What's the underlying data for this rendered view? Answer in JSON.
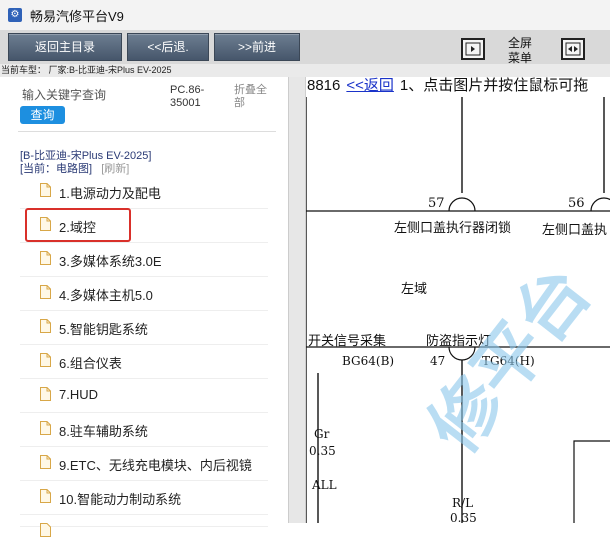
{
  "window": {
    "title": "畅易汽修平台V9"
  },
  "toolbar": {
    "home_label": "返回主目录",
    "back_label": "<<后退.",
    "forward_label": ">>前进",
    "fullscreen_line1": "全屏",
    "fullscreen_line2": "菜单",
    "cut_label_line1": "​",
    "cut_label_line2": "​"
  },
  "vehicle_line": "当前车型： 厂家:B-比亚迪-宋Plus EV-2025",
  "search": {
    "placeholder": "输入关键字查询",
    "button": "查询"
  },
  "pc_code": "PC.86-35001",
  "fold_all": "折叠全部",
  "model_name": "[B-比亚迪-宋Plus EV-2025]",
  "current_path": {
    "prefix": "[当前：电路图]",
    "refresh": "[刷新]"
  },
  "tree_items": [
    "1.电源动力及配电",
    "2.域控",
    "3.多媒体系统3.0E",
    "4.多媒体主机5.0",
    "5.智能钥匙系统",
    "6.组合仪表",
    "7.HUD",
    "8.驻车辅助系统",
    "9.ETC、无线充电模块、内后视镜",
    "10.智能动力制动系统"
  ],
  "viewer": {
    "doc_number": "8816",
    "back_link": "<<返回",
    "instruction": "1、点击图片并按住鼠标可拖"
  },
  "diagram": {
    "pin_57": "57",
    "pin_56": "56",
    "label_left_lock": "左侧口盖执行器闭锁",
    "label_left_lock_2": "左侧口盖执",
    "label_left_domain": "左域",
    "label_switch_signal": "开关信号采集",
    "label_antitheft": "防盗指示灯",
    "conn_bg64": "BG64(B)",
    "pin_47": "47",
    "conn_tg64": "TG64(H)",
    "wire_gr": "Gr",
    "wire_gr_size": "0.35",
    "wire_all": "ALL",
    "wire_rl": "R/L",
    "wire_rl_size": "0.35",
    "watermark": "修平台"
  }
}
